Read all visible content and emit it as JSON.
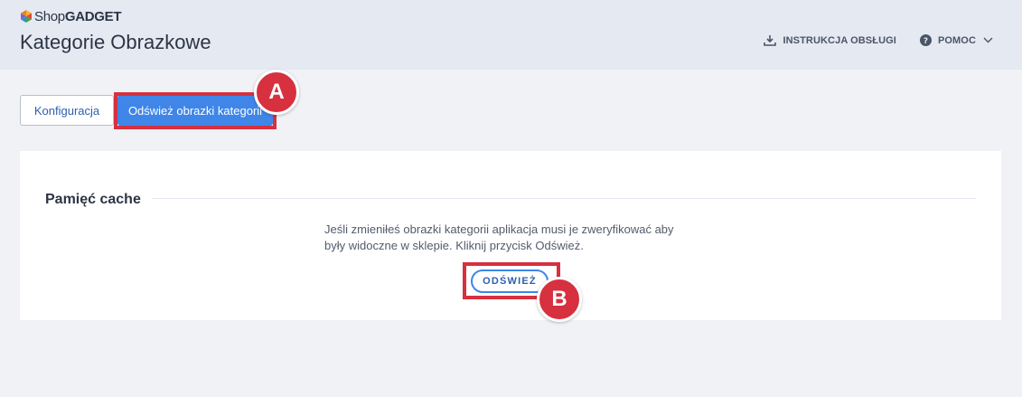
{
  "header": {
    "logo_shop": "Shop",
    "logo_gadget": "GADGET",
    "title": "Kategorie Obrazkowe",
    "manual_label": "INSTRUKCJA OBSŁUGI",
    "help_label": "POMOC",
    "icons": {
      "manual": "download-icon",
      "help": "question-circle-icon",
      "help_dropdown": "chevron-down-icon"
    }
  },
  "toolbar": {
    "config_label": "Konfiguracja",
    "refresh_all_label": "Odśwież obrazki kategorii"
  },
  "cache": {
    "title": "Pamięć cache",
    "description": "Jeśli zmieniłeś obrazki kategorii aplikacja musi je zweryfikować aby były widoczne w sklepie. Kliknij przycisk Odśwież.",
    "refresh_label": "ODŚWIEŻ"
  },
  "annotations": {
    "a": "A",
    "b": "B"
  },
  "colors": {
    "accent": "#3f86e8",
    "highlight": "#d7303f",
    "header_bg": "#e5e9f1",
    "page_bg": "#f1f2f6"
  }
}
